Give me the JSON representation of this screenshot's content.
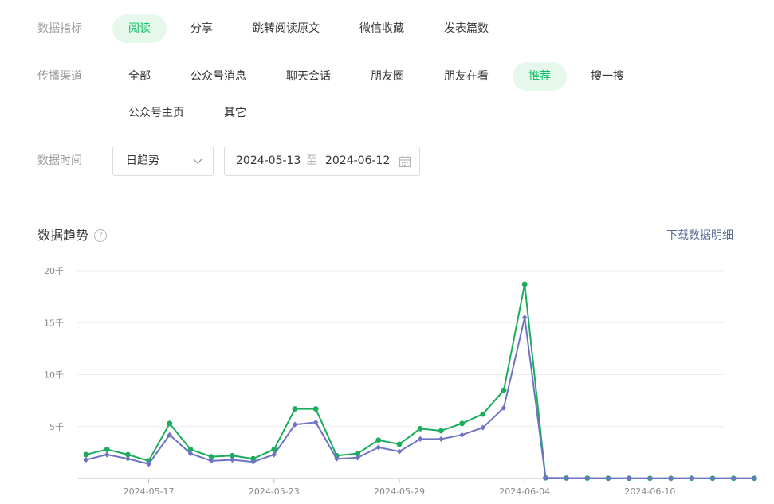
{
  "filters": {
    "metric": {
      "label": "数据指标",
      "options": [
        "阅读",
        "分享",
        "跳转阅读原文",
        "微信收藏",
        "发表篇数"
      ],
      "selected": "阅读"
    },
    "channel": {
      "label": "传播渠道",
      "options": [
        "全部",
        "公众号消息",
        "聊天会话",
        "朋友圈",
        "朋友在看",
        "推荐",
        "搜一搜",
        "公众号主页",
        "其它"
      ],
      "selected": "推荐"
    },
    "time": {
      "label": "数据时间",
      "granularity": "日趋势",
      "start": "2024-05-13",
      "separator": "至",
      "end": "2024-06-12"
    }
  },
  "trend": {
    "title": "数据趋势",
    "help": "?",
    "download_label": "下载数据明细"
  },
  "colors": {
    "accent": "#07c160",
    "series_green": "#1aad5e",
    "series_purple": "#6f73c3",
    "link": "#576b95"
  },
  "chart_data": {
    "type": "line",
    "x": [
      "2024-05-14",
      "2024-05-15",
      "2024-05-16",
      "2024-05-17",
      "2024-05-18",
      "2024-05-19",
      "2024-05-20",
      "2024-05-21",
      "2024-05-22",
      "2024-05-23",
      "2024-05-24",
      "2024-05-25",
      "2024-05-26",
      "2024-05-27",
      "2024-05-28",
      "2024-05-29",
      "2024-05-30",
      "2024-05-31",
      "2024-06-01",
      "2024-06-02",
      "2024-06-03",
      "2024-06-04",
      "2024-06-05",
      "2024-06-06",
      "2024-06-07",
      "2024-06-08",
      "2024-06-09",
      "2024-06-10",
      "2024-06-11",
      "2024-06-12",
      "2024-06-13",
      "2024-06-14",
      "2024-06-15"
    ],
    "x_tick_labels": [
      "2024-05-17",
      "2024-05-23",
      "2024-05-29",
      "2024-06-04",
      "2024-06-10"
    ],
    "y_tick_labels": [
      "5千",
      "10千",
      "15千",
      "20千"
    ],
    "y_ticks": [
      5000,
      10000,
      15000,
      20000
    ],
    "ylim": [
      0,
      20000
    ],
    "grid": true,
    "series": [
      {
        "color": "#1aad5e",
        "values": [
          2300,
          2800,
          2300,
          1700,
          5300,
          2800,
          2100,
          2200,
          1900,
          2800,
          6700,
          6700,
          2200,
          2400,
          3700,
          3300,
          4800,
          4600,
          5300,
          6200,
          8500,
          18700,
          60,
          40,
          30,
          20,
          20,
          20,
          20,
          20,
          20,
          20,
          20
        ]
      },
      {
        "color": "#6f73c3",
        "values": [
          1800,
          2300,
          1900,
          1400,
          4200,
          2400,
          1700,
          1800,
          1600,
          2300,
          5200,
          5400,
          1900,
          2000,
          3000,
          2600,
          3800,
          3800,
          4200,
          4900,
          6800,
          15500,
          60,
          40,
          30,
          20,
          20,
          20,
          20,
          20,
          20,
          20,
          20
        ]
      }
    ]
  }
}
